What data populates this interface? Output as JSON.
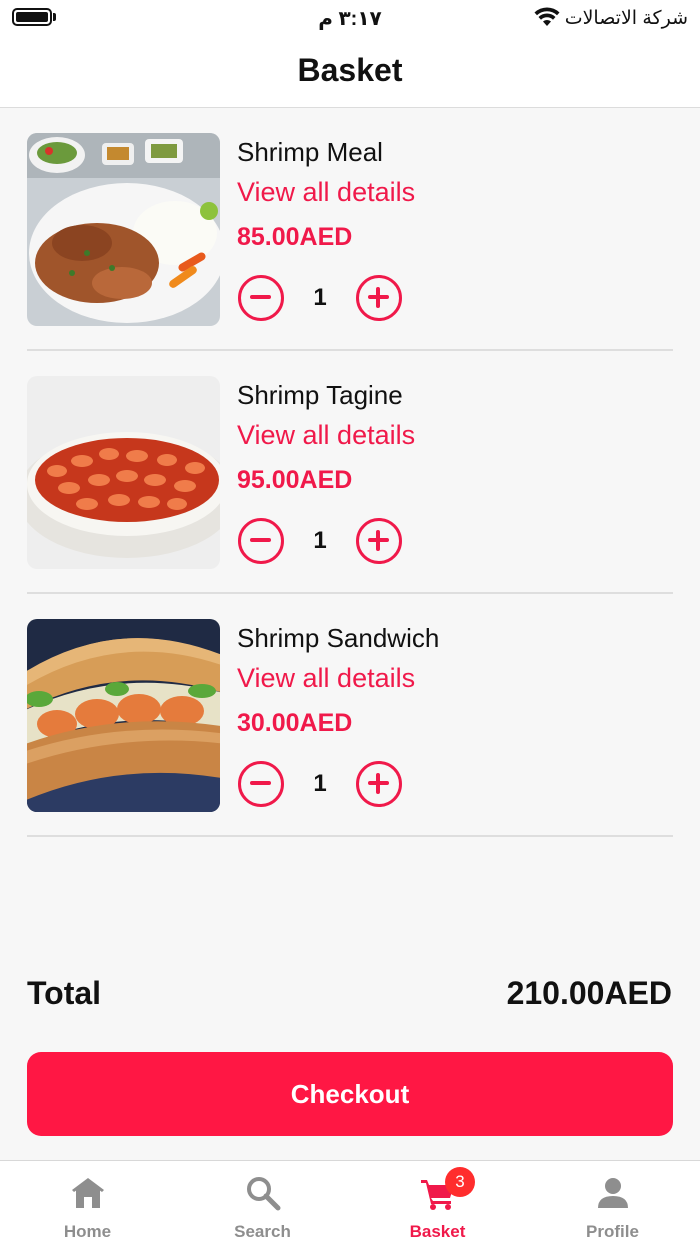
{
  "status_bar": {
    "time": "٣:١٧ م",
    "carrier": "شركة الاتصالات"
  },
  "header": {
    "title": "Basket"
  },
  "items": [
    {
      "name": "Shrimp Meal",
      "details_link": "View all details",
      "price": "85.00AED",
      "quantity": "1",
      "image": "shrimp-meal-photo"
    },
    {
      "name": "Shrimp Tagine",
      "details_link": "View all details",
      "price": "95.00AED",
      "quantity": "1",
      "image": "shrimp-tagine-photo"
    },
    {
      "name": "Shrimp Sandwich",
      "details_link": "View all details",
      "price": "30.00AED",
      "quantity": "1",
      "image": "shrimp-sandwich-photo"
    }
  ],
  "summary": {
    "total_label": "Total",
    "total_value": "210.00AED"
  },
  "checkout_label": "Checkout",
  "tab_bar": {
    "tabs": [
      {
        "label": "Home",
        "icon": "home-icon"
      },
      {
        "label": "Search",
        "icon": "search-icon"
      },
      {
        "label": "Basket",
        "icon": "cart-icon",
        "badge": "3",
        "active": true
      },
      {
        "label": "Profile",
        "icon": "profile-icon"
      }
    ]
  },
  "colors": {
    "accent": "#f0194a",
    "checkout": "#ff1744",
    "badge": "#ff2d2d",
    "inactive_tab": "#8e8e8e"
  }
}
